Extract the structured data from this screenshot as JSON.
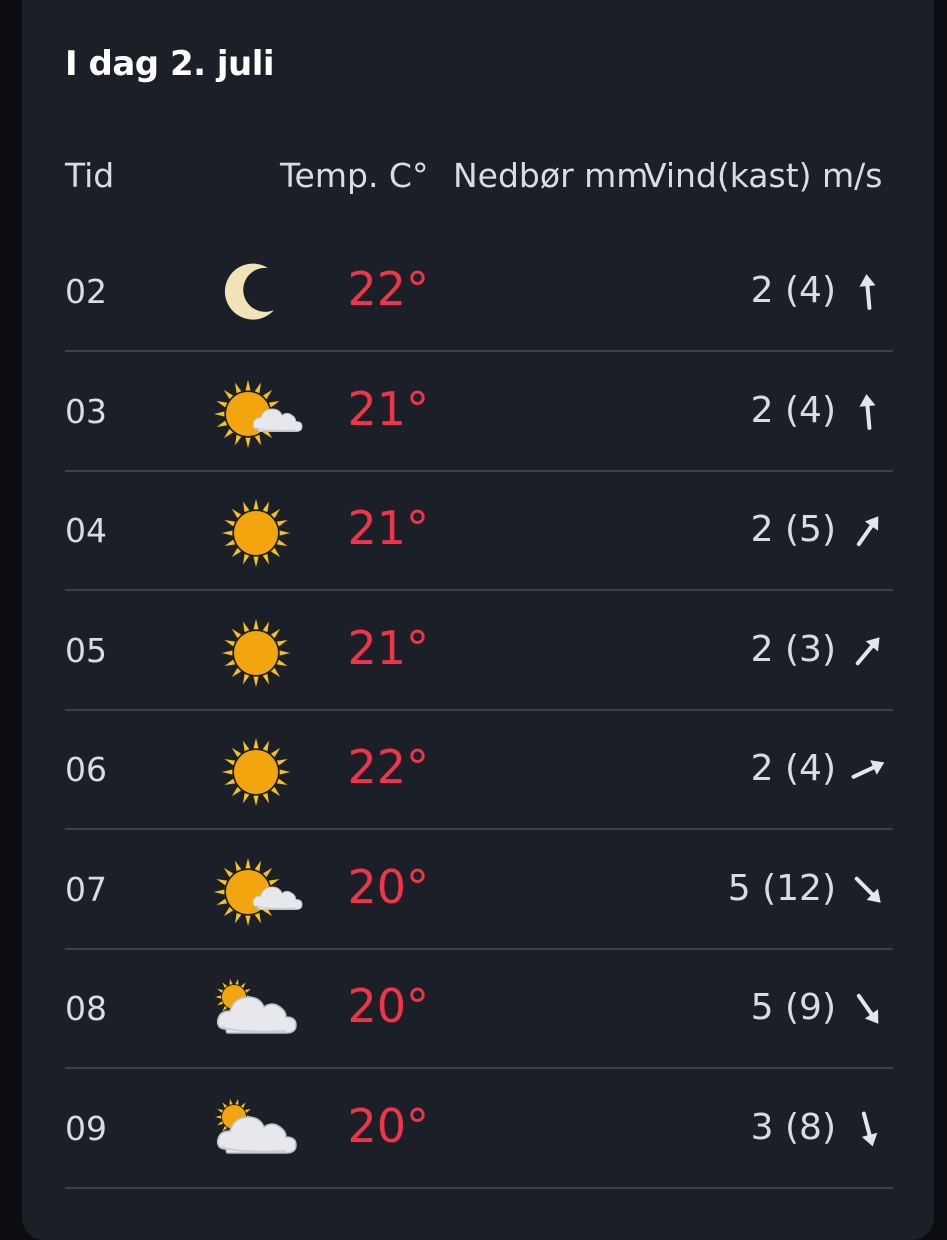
{
  "title": "I dag 2. juli",
  "headers": {
    "time": "Tid",
    "temp": "Temp. C°",
    "precip": "Nedbør mm",
    "wind": "Vind(kast) m/s"
  },
  "colors": {
    "temp": "#f0354a",
    "background": "#1b2028",
    "text": "#d9dce1"
  },
  "rows": [
    {
      "time": "02",
      "icon": "moon-icon",
      "temp": "22°",
      "wind": "2 (4)",
      "wind_dir_deg": 355
    },
    {
      "time": "03",
      "icon": "sun-cloud-small-icon",
      "temp": "21°",
      "wind": "2 (4)",
      "wind_dir_deg": 355
    },
    {
      "time": "04",
      "icon": "sun-icon",
      "temp": "21°",
      "wind": "2 (5)",
      "wind_dir_deg": 35
    },
    {
      "time": "05",
      "icon": "sun-icon",
      "temp": "21°",
      "wind": "2 (3)",
      "wind_dir_deg": 40
    },
    {
      "time": "06",
      "icon": "sun-icon",
      "temp": "22°",
      "wind": "2 (4)",
      "wind_dir_deg": 65
    },
    {
      "time": "07",
      "icon": "sun-cloud-small-icon",
      "temp": "20°",
      "wind": "5 (12)",
      "wind_dir_deg": 135
    },
    {
      "time": "08",
      "icon": "cloud-sun-icon",
      "temp": "20°",
      "wind": "5 (9)",
      "wind_dir_deg": 145
    },
    {
      "time": "09",
      "icon": "cloud-sun-icon",
      "temp": "20°",
      "wind": "3 (8)",
      "wind_dir_deg": 165
    }
  ]
}
